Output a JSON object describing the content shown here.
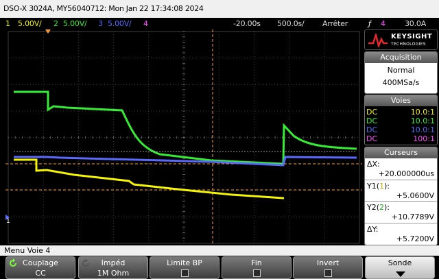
{
  "title": "DSO-X 3024A, MY56040712: Mon Jan 22 17:34:08 2024",
  "status": {
    "ch1": "1",
    "ch1_scale": "5.00V/",
    "ch2": "2",
    "ch2_scale": "5.00V/",
    "ch3": "3",
    "ch3_scale": "5.00V/",
    "ch4": "4",
    "delay": "-20.00s",
    "timebase": "500.0s/",
    "run_state": "Arrêter",
    "trigger_icon": "ƒ",
    "trig_src": "4",
    "trig_level": "30.0A"
  },
  "logo": {
    "brand": "KEYSIGHT",
    "sub": "TECHNOLOGIES"
  },
  "acquisition": {
    "header": "Acquisition",
    "mode": "Normal",
    "rate": "400MSa/s"
  },
  "voies": {
    "header": "Voies",
    "rows": [
      {
        "coupling": "DC",
        "probe": "10.0:1",
        "color": "#f5f500"
      },
      {
        "coupling": "DC",
        "probe": "10.0:1",
        "color": "#33ee33"
      },
      {
        "coupling": "DC",
        "probe": "10.0:1",
        "color": "#5a6aff"
      },
      {
        "coupling": "DC",
        "probe": "100:1",
        "color": "#ff50ff"
      }
    ]
  },
  "curseurs": {
    "header": "Curseurs",
    "dx_label": "ΔX:",
    "dx_value": "+20.000000us",
    "y1_label": "Y1",
    "y1_src": "1",
    "y1_value": "+5.0600V",
    "y2_label": "Y2",
    "y2_src": "2",
    "y2_value": "+10.7789V",
    "dy_label": "ΔY:",
    "dy_value": "+5.7200V"
  },
  "menu_title": "Menu Voie 4",
  "softkeys": [
    {
      "label": "Couplage",
      "value": "CC"
    },
    {
      "label": "Impéd",
      "value": "1M Ohm"
    },
    {
      "label": "Limite BP",
      "value": ""
    },
    {
      "label": "Fin",
      "value": ""
    },
    {
      "label": "Invert",
      "value": ""
    },
    {
      "label": "Sonde",
      "value": ""
    }
  ],
  "ground_marker": "1",
  "colors": {
    "ch1": "#f5f500",
    "ch2": "#33ee33",
    "ch3": "#5a6aff",
    "ch4": "#ff50ff",
    "cursor": "#ff9933",
    "trigger": "#ff9933"
  }
}
